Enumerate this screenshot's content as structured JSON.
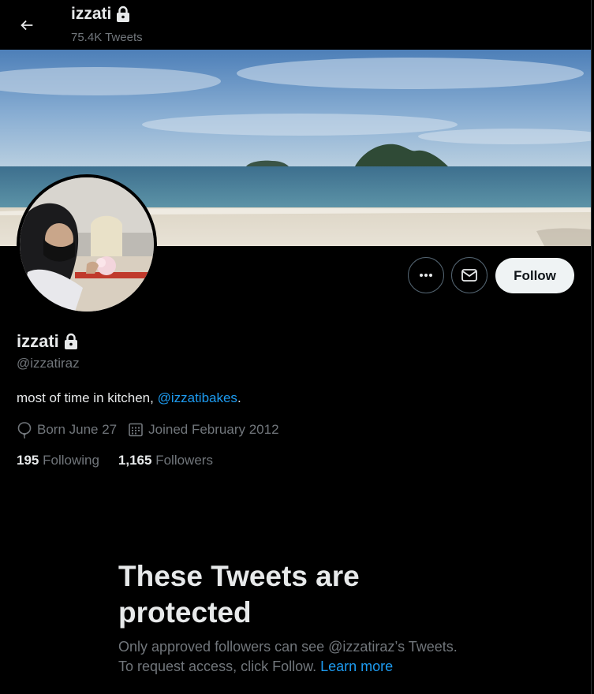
{
  "header": {
    "title": "izzati",
    "tweet_count": "75.4K Tweets"
  },
  "profile": {
    "name": "izzati",
    "handle": "@izzatiraz",
    "bio_text": "most of time in kitchen, ",
    "bio_link": "@izzatibakes",
    "bio_end": ".",
    "birthday": "Born June 27",
    "joined": "Joined February 2012",
    "following_count": "195",
    "following_label": "Following",
    "followers_count": "1,165",
    "followers_label": "Followers"
  },
  "actions": {
    "follow_label": "Follow",
    "more_icon": "more-icon",
    "message_icon": "mail-icon"
  },
  "protected": {
    "title": "These Tweets are protected",
    "line1": "Only approved followers can see @izzatiraz’s Tweets.",
    "line2": "To request access, click Follow. ",
    "learn_more": "Learn more"
  },
  "colors": {
    "background": "#000000",
    "text_primary": "#e7e9ea",
    "text_secondary": "#71767b",
    "accent": "#1d9bf0",
    "follow_button_bg": "#eff3f4"
  }
}
